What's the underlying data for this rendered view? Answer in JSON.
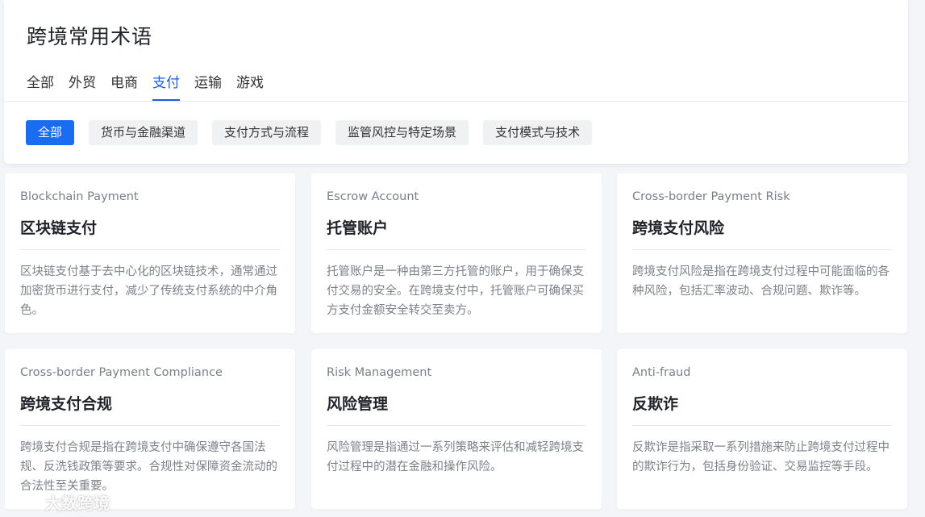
{
  "page": {
    "title": "跨境常用术语"
  },
  "main_tabs": [
    {
      "label": "全部"
    },
    {
      "label": "外贸"
    },
    {
      "label": "电商"
    },
    {
      "label": "支付"
    },
    {
      "label": "运输"
    },
    {
      "label": "游戏"
    }
  ],
  "active_main_tab": "支付",
  "sub_tabs": [
    {
      "label": "全部"
    },
    {
      "label": "货币与金融渠道"
    },
    {
      "label": "支付方式与流程"
    },
    {
      "label": "监管风控与特定场景"
    },
    {
      "label": "支付模式与技术"
    }
  ],
  "active_sub_tab": "全部",
  "cards": [
    {
      "en": "Blockchain Payment",
      "cn": "区块链支付",
      "desc": "区块链支付基于去中心化的区块链技术，通常通过加密货币进行支付，减少了传统支付系统的中介角色。"
    },
    {
      "en": "Escrow Account",
      "cn": "托管账户",
      "desc": "托管账户是一种由第三方托管的账户，用于确保支付交易的安全。在跨境支付中，托管账户可确保买方支付金额安全转交至卖方。"
    },
    {
      "en": "Cross-border Payment Risk",
      "cn": "跨境支付风险",
      "desc": "跨境支付风险是指在跨境支付过程中可能面临的各种风险，包括汇率波动、合规问题、欺诈等。"
    },
    {
      "en": "Cross-border Payment Compliance",
      "cn": "跨境支付合规",
      "desc": "跨境支付合规是指在跨境支付中确保遵守各国法规、反洗钱政策等要求。合规性对保障资金流动的合法性至关重要。"
    },
    {
      "en": "Risk Management",
      "cn": "风险管理",
      "desc": "风险管理是指通过一系列策略来评估和减轻跨境支付过程中的潜在金融和操作风险。"
    },
    {
      "en": "Anti-fraud",
      "cn": "反欺诈",
      "desc": "反欺诈是指采取一系列措施来防止跨境支付过程中的欺诈行为，包括身份验证、交易监控等手段。"
    }
  ],
  "watermark": {
    "text": "大数跨境"
  },
  "colors": {
    "accent": "#1a6cf0",
    "tab_active": "#1a5fd6"
  }
}
